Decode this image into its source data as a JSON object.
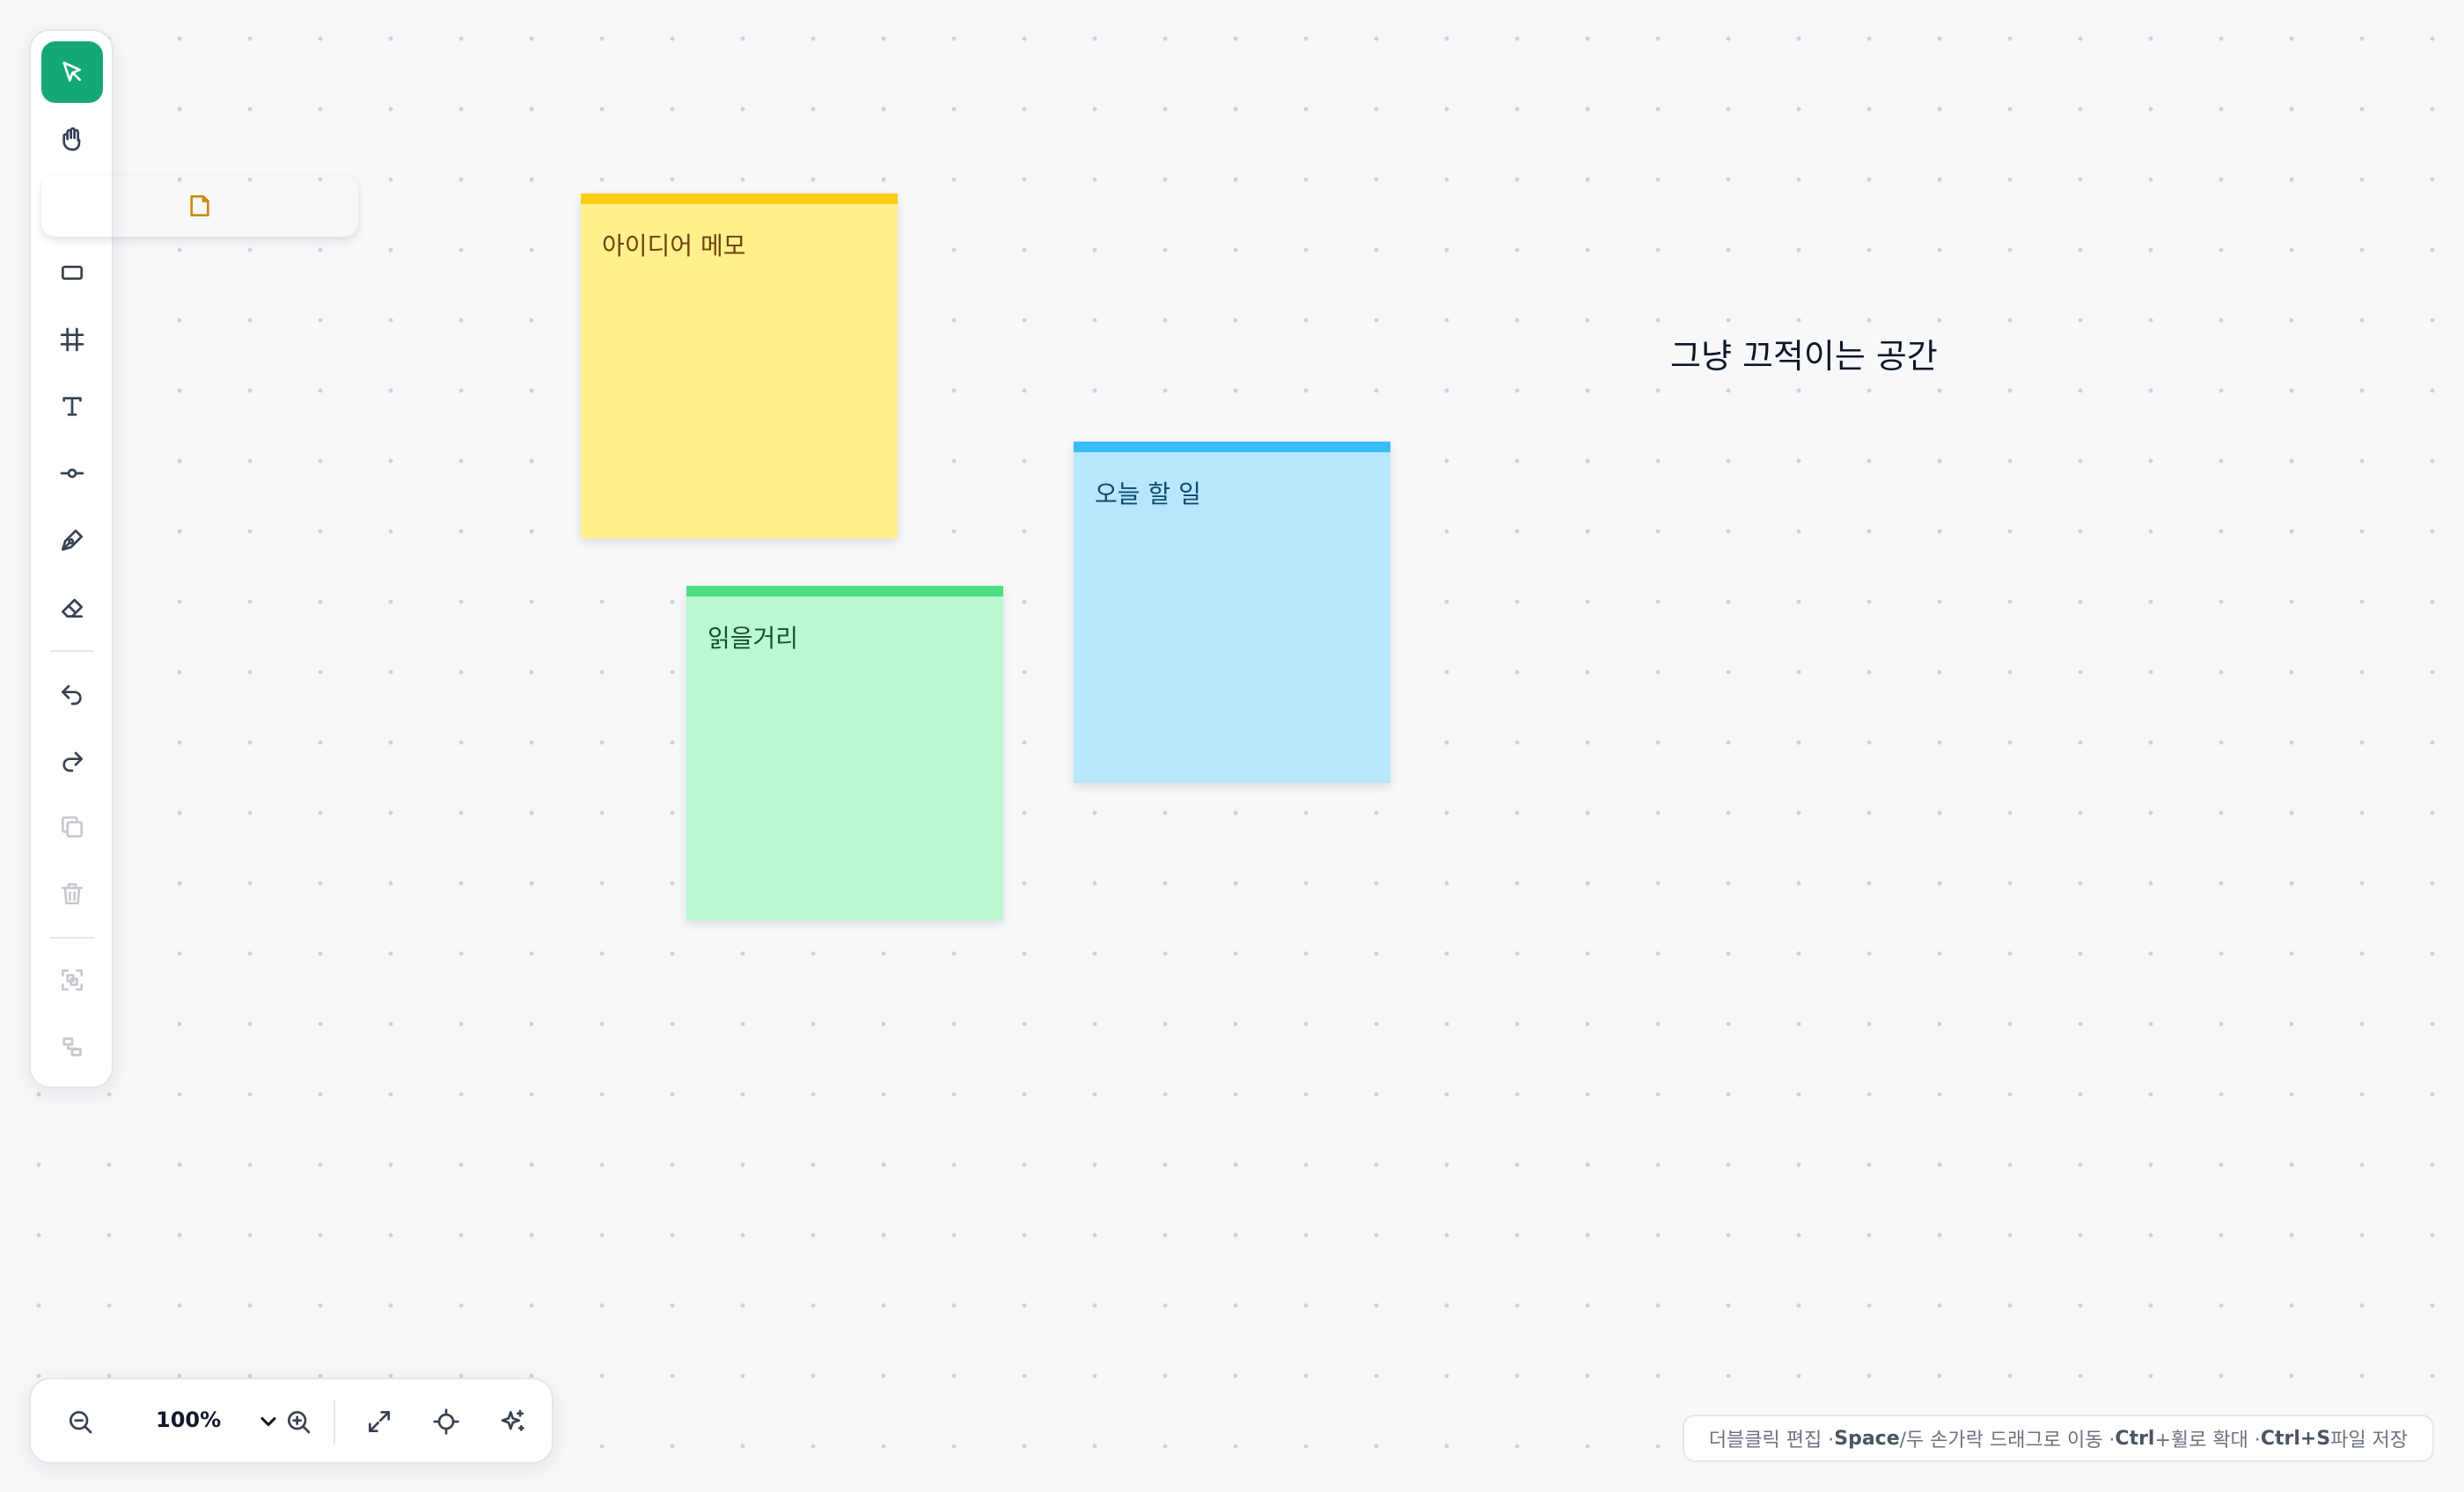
{
  "toolbar": {
    "tools": [
      {
        "name": "select",
        "icon": "cursor-icon",
        "active": true
      },
      {
        "name": "hand",
        "icon": "hand-icon"
      },
      {
        "name": "sticky-note",
        "icon": "sticky-note-icon"
      },
      {
        "name": "rectangle",
        "icon": "rectangle-icon"
      },
      {
        "name": "frame",
        "icon": "frame-icon"
      },
      {
        "name": "text",
        "icon": "text-icon"
      },
      {
        "name": "connector",
        "icon": "connector-icon"
      },
      {
        "name": "pen",
        "icon": "pen-icon"
      },
      {
        "name": "eraser",
        "icon": "eraser-icon"
      },
      {
        "name": "undo",
        "icon": "undo-icon"
      },
      {
        "name": "redo",
        "icon": "redo-icon"
      },
      {
        "name": "duplicate",
        "icon": "copy-icon",
        "disabled": true
      },
      {
        "name": "delete",
        "icon": "trash-icon",
        "disabled": true
      },
      {
        "name": "group",
        "icon": "group-icon",
        "disabled": true
      },
      {
        "name": "align",
        "icon": "align-icon",
        "disabled": true
      }
    ]
  },
  "canvas": {
    "notes": [
      {
        "text": "아이디어 메모",
        "color": "yellow"
      },
      {
        "text": "오늘 할 일",
        "color": "blue"
      },
      {
        "text": "읽을거리",
        "color": "green"
      }
    ],
    "free_text": "그냥 끄적이는 공간"
  },
  "zoom": {
    "value": "100%"
  },
  "hint": {
    "part1": "더블클릭 편집 · ",
    "key1": "Space",
    "part2": "/두 손가락 드래그로 이동 · ",
    "key2": "Ctrl",
    "part3": "+휠로 확대 · ",
    "key3": "Ctrl+S",
    "part4": " 파일 저장"
  },
  "colors": {
    "accent": "#15a877",
    "note_yellow": "#fef08a",
    "note_blue": "#bae6fd",
    "note_green": "#bbf7d0"
  }
}
